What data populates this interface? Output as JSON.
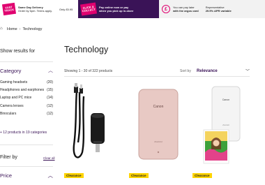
{
  "promo": {
    "fast_track": "FAST TRACK",
    "same_day_title": "Same Day Delivery",
    "same_day_sub": "Order by 6pm. Terms apply.",
    "same_day_price": "Only £5.95",
    "click_collect": "CLICK & COLLECT",
    "pay_line1": "Pay online now or pay",
    "pay_line2": "when you pick up in-store",
    "argos_card_line1": "You can pay later",
    "argos_card_line2": "with the argos card",
    "apr_line1": "Representative",
    "apr_line2": "29.9% APR variable"
  },
  "breadcrumb": {
    "home": "Home",
    "separator": "›",
    "current": "Technology"
  },
  "sidebar": {
    "show_results_for": "Show results for",
    "category_label": "Category",
    "categories": [
      {
        "label": "Gaming headsets",
        "count": "(20)"
      },
      {
        "label": "Headphones and earphones",
        "count": "(15)"
      },
      {
        "label": "Laptop and PC mice",
        "count": "(14)"
      },
      {
        "label": "Camera lenses",
        "count": "(12)"
      },
      {
        "label": "Binoculars",
        "count": "(12)"
      }
    ],
    "more_categories": "+ 12 products in 19 categories",
    "filter_by": "Filter by",
    "clear_all": "Clear all",
    "price_label": "Price"
  },
  "main": {
    "title": "Technology",
    "showing": "Showing 1 - 30 of 322 products",
    "sort_by_label": "Sort by",
    "sort_value": "Relevance"
  },
  "products": [
    {
      "badge": "Clearance"
    },
    {
      "badge": "Clearance"
    },
    {
      "badge": "Clearance"
    }
  ],
  "colors": {
    "brand_purple": "#3a1357",
    "magenta": "#e0006f",
    "clearance_yellow": "#ffd400"
  },
  "icons": [
    "home-icon",
    "chevron-up-icon",
    "chevron-down-icon",
    "pound-icon"
  ]
}
